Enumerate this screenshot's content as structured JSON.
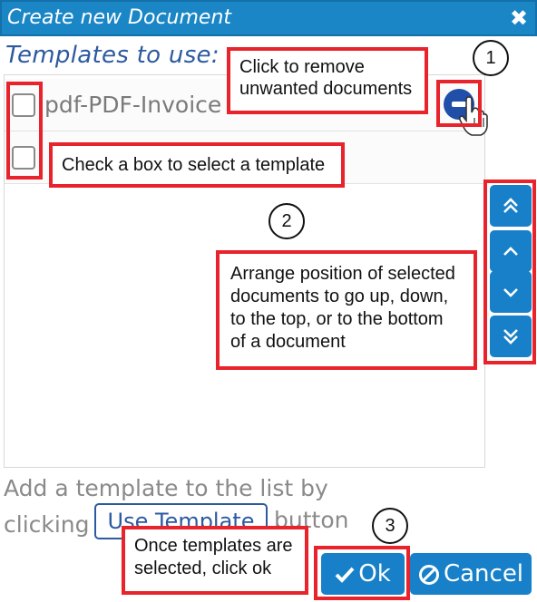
{
  "dialog": {
    "title": "Create new Document",
    "close_glyph": "✖"
  },
  "templates": {
    "label": "Templates to use:",
    "rows": [
      {
        "text": "pdf-PDF-Invoice",
        "checked": false
      },
      {
        "text": "",
        "checked": false
      }
    ]
  },
  "order_buttons": [
    "move-top",
    "move-up",
    "move-down",
    "move-bottom"
  ],
  "helper": {
    "line1": "Add a template to the list by",
    "line2_start": "clicking",
    "use_template_label": "Use Template",
    "line2_end": "button"
  },
  "footer": {
    "ok_label": "Ok",
    "cancel_label": "Cancel"
  },
  "annotations": {
    "remove_note": "Click to remove unwanted documents",
    "checkbox_note": "Check a box to select a template",
    "arrange_note": "Arrange position of selected documents to go up, down, to the top, or to the bottom of a document",
    "ok_note": "Once templates are selected, click ok",
    "step1": "1",
    "step2": "2",
    "step3": "3"
  },
  "colors": {
    "accent": "#1780c8",
    "annotation_red": "#e8232c",
    "label_blue": "#2c5aa0"
  }
}
